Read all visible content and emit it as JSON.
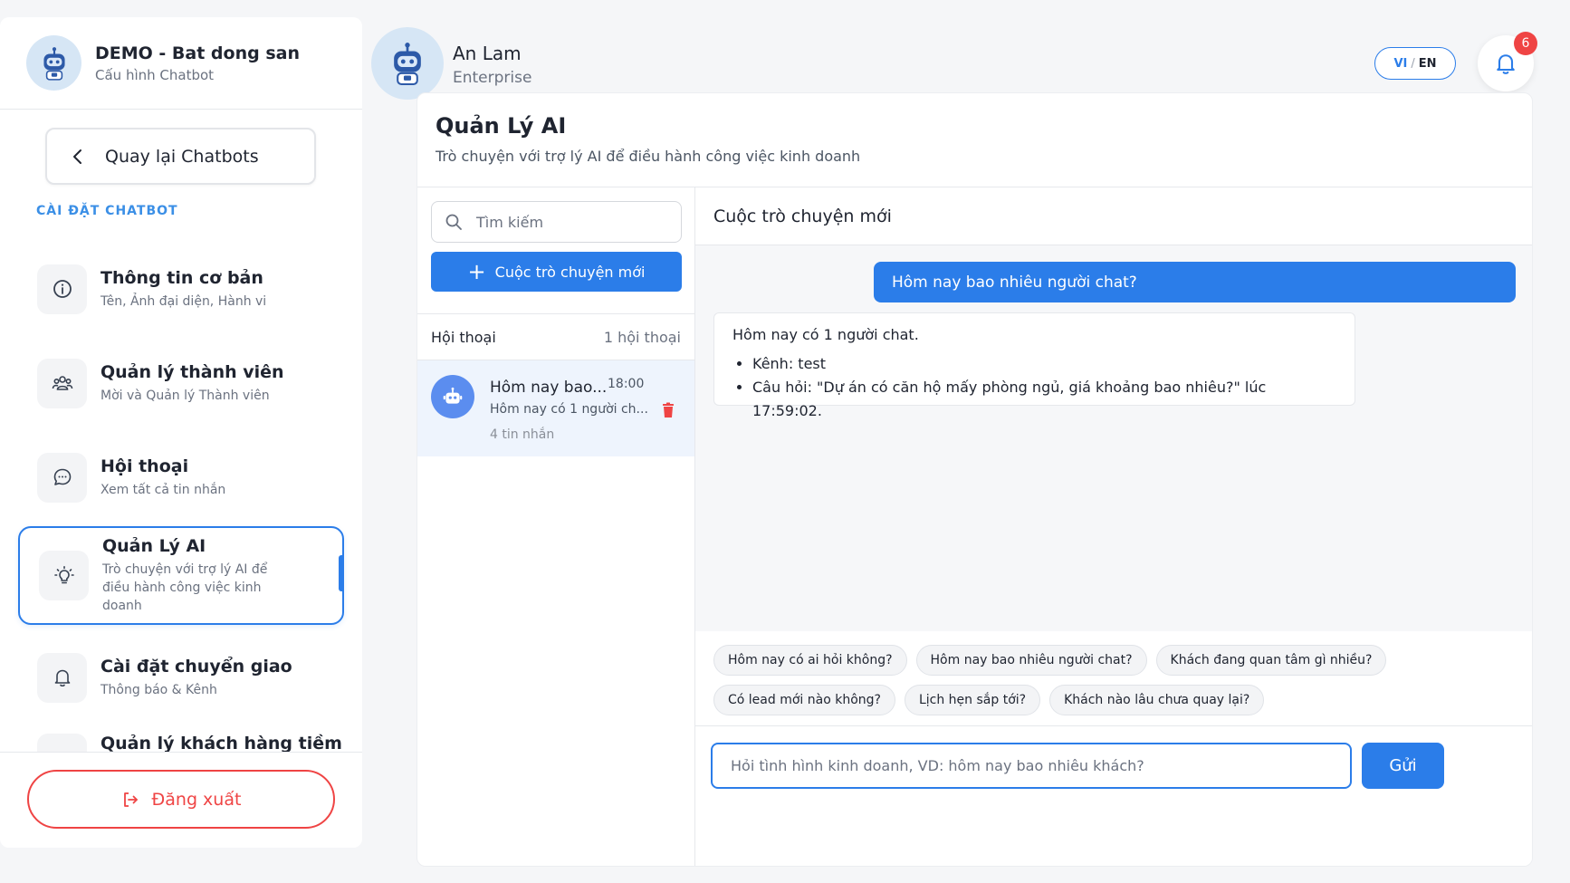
{
  "sidebar": {
    "title": "DEMO - Bat dong san",
    "subtitle": "Cấu hình Chatbot",
    "back_label": "Quay lại Chatbots",
    "section_label": "CÀI ĐẶT CHATBOT",
    "items": [
      {
        "title": "Thông tin cơ bản",
        "desc": "Tên, Ảnh đại diện, Hành vi",
        "icon": "info-icon"
      },
      {
        "title": "Quản lý thành viên",
        "desc": "Mời và Quản lý Thành viên",
        "icon": "users-icon"
      },
      {
        "title": "Hội thoại",
        "desc": "Xem tất cả tin nhắn",
        "icon": "chat-bubble-icon"
      },
      {
        "title": "Quản Lý AI",
        "desc": "Trò chuyện với trợ lý AI để điều hành công việc kinh doanh",
        "icon": "lightbulb-icon",
        "active": true
      },
      {
        "title": "Cài đặt chuyển giao",
        "desc": "Thông báo & Kênh",
        "icon": "bell-icon"
      },
      {
        "title": "Quản lý khách hàng tiềm",
        "desc": "",
        "icon": "users-icon"
      }
    ],
    "logout_label": "Đăng xuất"
  },
  "topbar": {
    "user_name": "An Lam",
    "user_plan": "Enterprise",
    "lang_active": "VI",
    "lang_sep": "/",
    "lang_other": "EN",
    "notification_count": "6"
  },
  "page": {
    "title": "Quản Lý AI",
    "subtitle": "Trò chuyện với trợ lý AI để điều hành công việc kinh doanh"
  },
  "conversations": {
    "search_placeholder": "Tìm kiếm",
    "new_button_label": "Cuộc trò chuyện mới",
    "header_label": "Hội thoại",
    "header_count": "1 hội thoại",
    "items": [
      {
        "title": "Hôm nay bao...",
        "time": "18:00",
        "snippet": "Hôm nay có 1 người ch...",
        "count": "4 tin nhắn"
      }
    ]
  },
  "chat": {
    "title": "Cuộc trò chuyện mới",
    "user_message": "Hôm nay bao nhiêu người chat?",
    "bot_intro": "Hôm nay có 1 người chat.",
    "bot_bullets": [
      "Kênh: test",
      "Câu hỏi: \"Dự án có căn hộ mấy phòng ngủ, giá khoảng bao nhiêu?\" lúc 17:59:02."
    ],
    "suggestions_row1": [
      "Hôm nay có ai hỏi không?",
      "Hôm nay bao nhiêu người chat?",
      "Khách đang quan tâm gì nhiều?"
    ],
    "suggestions_row2": [
      "Có lead mới nào không?",
      "Lịch hẹn sắp tới?",
      "Khách nào lâu chưa quay lại?"
    ],
    "input_placeholder": "Hỏi tình hình kinh doanh, VD: hôm nay bao nhiêu khách?",
    "send_label": "Gửi"
  },
  "colors": {
    "accent": "#2b7de9",
    "danger": "#ef4444",
    "active_bg": "#eef4fd"
  }
}
